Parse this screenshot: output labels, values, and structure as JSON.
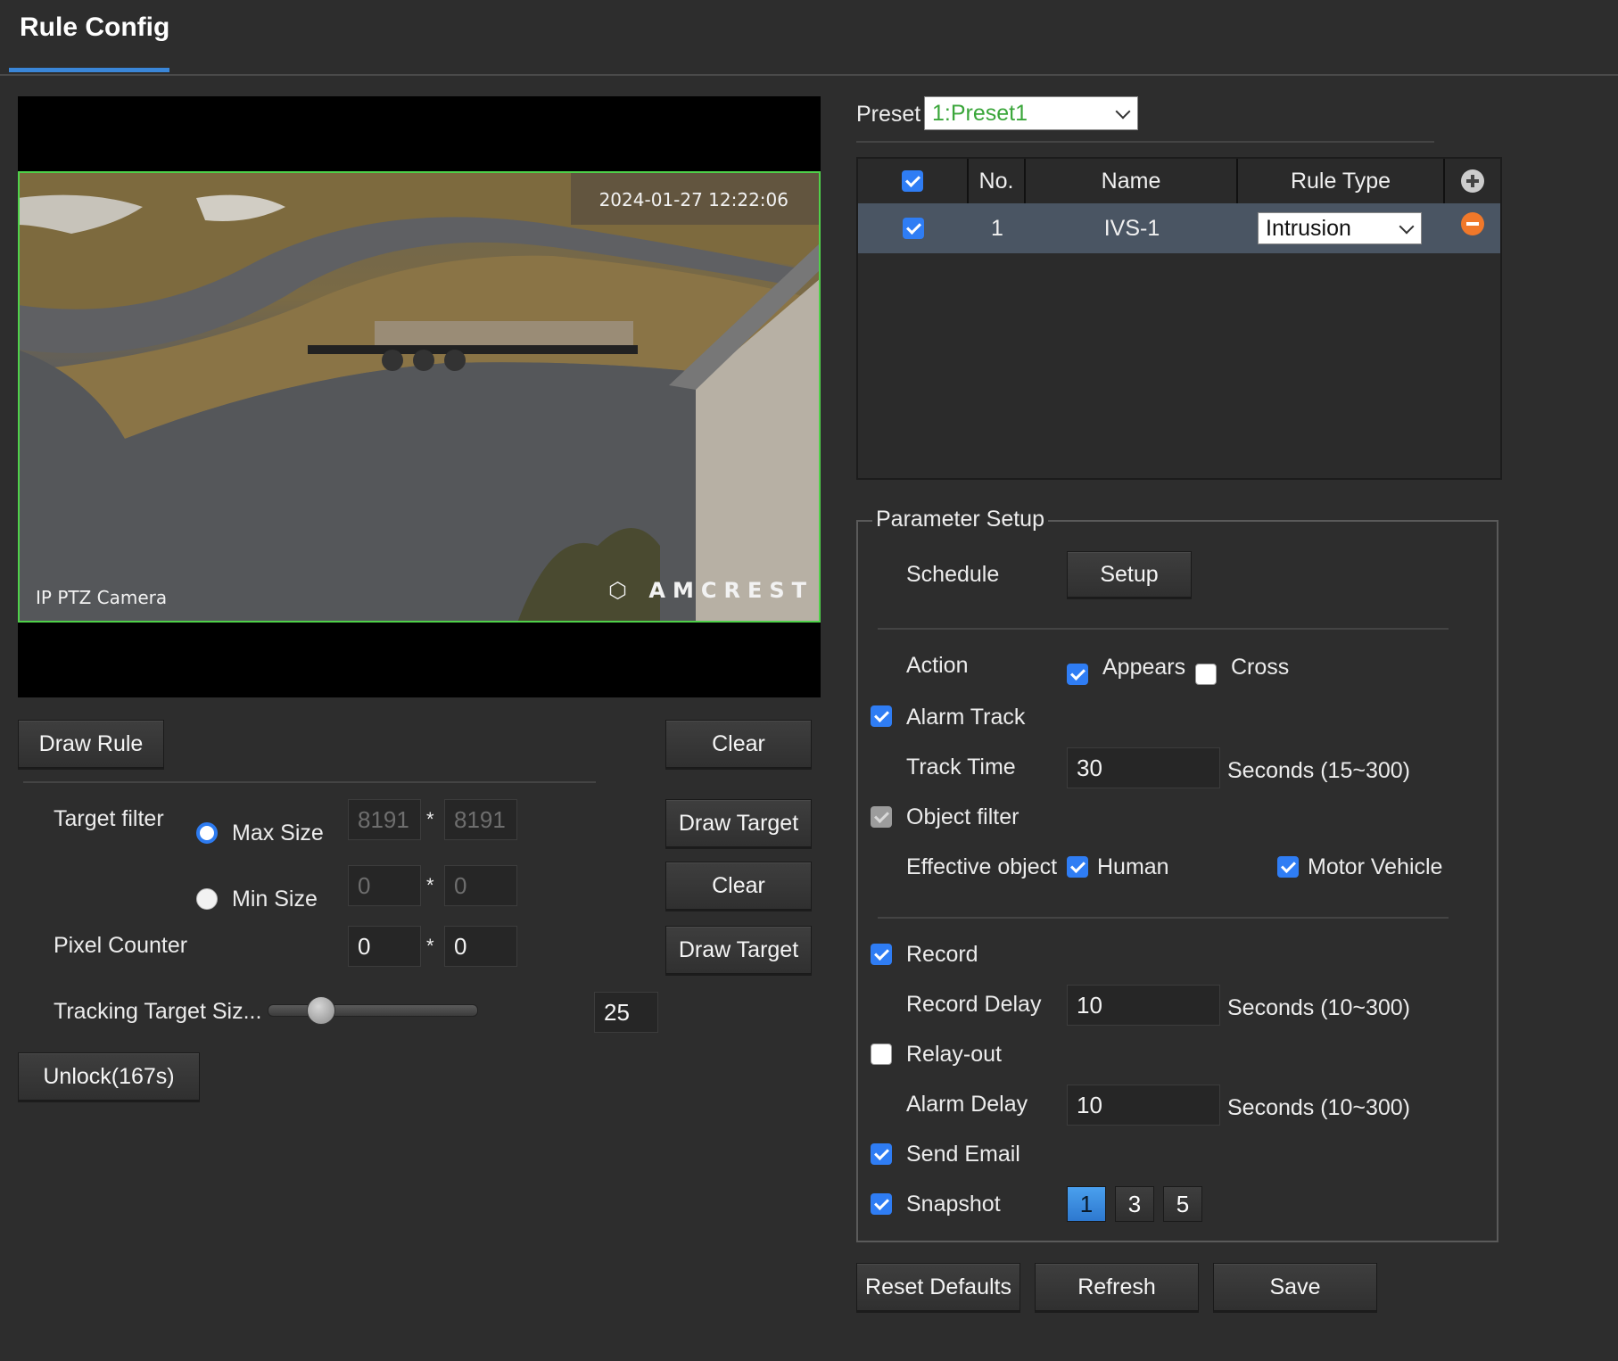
{
  "header": {
    "title": "Rule Config"
  },
  "video": {
    "osd_time": "2024-01-27 12:22:06",
    "osd_camera_name": "IP PTZ Camera",
    "osd_brand": "AMCREST"
  },
  "left_panel": {
    "draw_rule": "Draw Rule",
    "clear_1": "Clear",
    "target_filter_label": "Target filter",
    "max_size_label": "Max Size",
    "min_size_label": "Min Size",
    "max_w": "8191",
    "max_h": "8191",
    "min_w": "0",
    "min_h": "0",
    "times": "*",
    "draw_target_1": "Draw Target",
    "clear_2": "Clear",
    "pixel_counter_label": "Pixel Counter",
    "pixel_w": "0",
    "pixel_h": "0",
    "draw_target_2": "Draw Target",
    "tracking_target_label": "Tracking Target Siz...",
    "tracking_value": "25",
    "tracking_slider_fraction": 0.25,
    "unlock_label": "Unlock(167s)"
  },
  "preset": {
    "label": "Preset",
    "selected": "1:Preset1"
  },
  "rule_table": {
    "headers": {
      "no": "No.",
      "name": "Name",
      "rule_type": "Rule Type"
    },
    "rows": [
      {
        "checked": true,
        "no": "1",
        "name": "IVS-1",
        "rule_type": "Intrusion"
      }
    ]
  },
  "parameter_setup": {
    "legend": "Parameter Setup",
    "schedule_label": "Schedule",
    "setup_button": "Setup",
    "action_label": "Action",
    "appears_label": "Appears",
    "cross_label": "Cross",
    "alarm_track_label": "Alarm Track",
    "track_time_label": "Track Time",
    "track_time_value": "30",
    "track_time_range": "Seconds (15~300)",
    "object_filter_label": "Object filter",
    "effective_object_label": "Effective object",
    "human_label": "Human",
    "motor_vehicle_label": "Motor Vehicle",
    "record_label": "Record",
    "record_delay_label": "Record Delay",
    "record_delay_value": "10",
    "record_delay_range": "Seconds (10~300)",
    "relay_out_label": "Relay-out",
    "alarm_delay_label": "Alarm Delay",
    "alarm_delay_value": "10",
    "alarm_delay_range": "Seconds (10~300)",
    "send_email_label": "Send Email",
    "snapshot_label": "Snapshot",
    "snapshot_options": [
      "1",
      "3",
      "5"
    ]
  },
  "footer": {
    "reset_defaults": "Reset Defaults",
    "refresh": "Refresh",
    "save": "Save"
  },
  "colors": {
    "accent": "#3a86d8",
    "checkbox": "#2f7df4",
    "rule_box": "#4fd14a",
    "preset_text": "#3aa63a",
    "delete": "#f0782a"
  }
}
